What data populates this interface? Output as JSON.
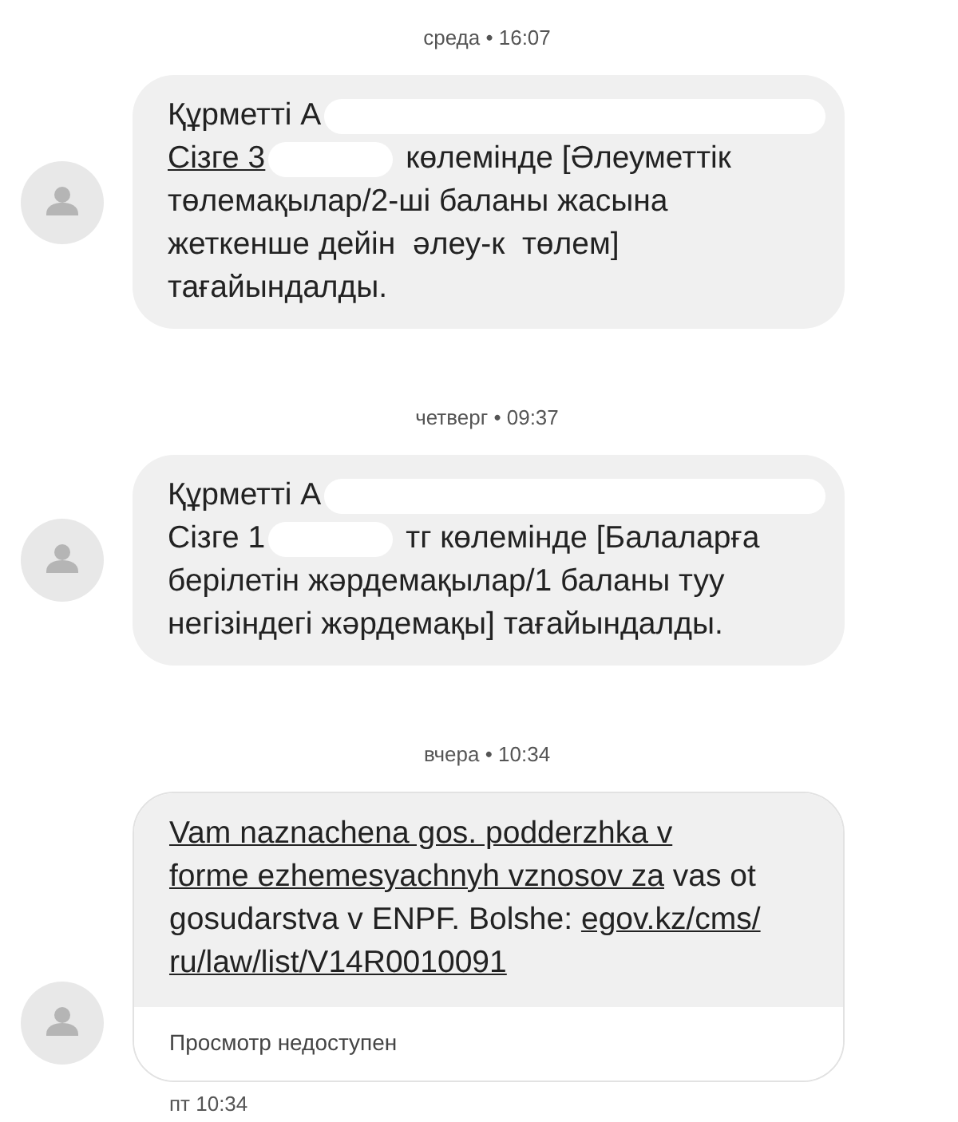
{
  "conversation": [
    {
      "date": "среда • 16:07",
      "message": {
        "lines": [
          [
            {
              "kind": "text",
              "text": "Құрметті А"
            },
            {
              "kind": "redacted"
            }
          ],
          [
            {
              "kind": "link",
              "text": "Сізге 3"
            },
            {
              "kind": "redacted"
            },
            {
              "kind": "text",
              "text": "көлемінде [Әлеуметтік"
            }
          ],
          [
            {
              "kind": "text",
              "text": "төлемақылар/2-ші баланы жасына"
            }
          ],
          [
            {
              "kind": "text",
              "text": "жеткенше дейін  әлеу-к  төлем]"
            }
          ],
          [
            {
              "kind": "text",
              "text": "тағайындалды."
            }
          ]
        ]
      }
    },
    {
      "date": "четверг • 09:37",
      "message": {
        "lines": [
          [
            {
              "kind": "text",
              "text": "Құрметті А"
            },
            {
              "kind": "redacted"
            }
          ],
          [
            {
              "kind": "text",
              "text": "Сізге 1"
            },
            {
              "kind": "redacted"
            },
            {
              "kind": "text",
              "text": "тг көлемінде [Балаларға"
            }
          ],
          [
            {
              "kind": "text",
              "text": "берілетін жәрдемақылар/1 баланы туу"
            }
          ],
          [
            {
              "kind": "text",
              "text": "негізіндегі жәрдемақы] тағайындалды."
            }
          ]
        ]
      }
    },
    {
      "date": "вчера • 10:34",
      "message": {
        "paragraph": [
          [
            {
              "kind": "link",
              "text": "Vam naznachena gos. podderzhka v"
            }
          ],
          [
            {
              "kind": "link",
              "text": "forme ezhemesyachnyh vznosov za"
            },
            {
              "kind": "text",
              "text": " vas ot"
            }
          ],
          [
            {
              "kind": "text",
              "text": "gosudarstva v ENPF. Bolshe: "
            },
            {
              "kind": "link",
              "text": "egov.kz/cms/"
            }
          ],
          [
            {
              "kind": "link",
              "text": "ru/law/list/V14R0010091"
            }
          ]
        ],
        "preview": "Просмотр недоступен",
        "time": "пт 10:34"
      }
    }
  ]
}
